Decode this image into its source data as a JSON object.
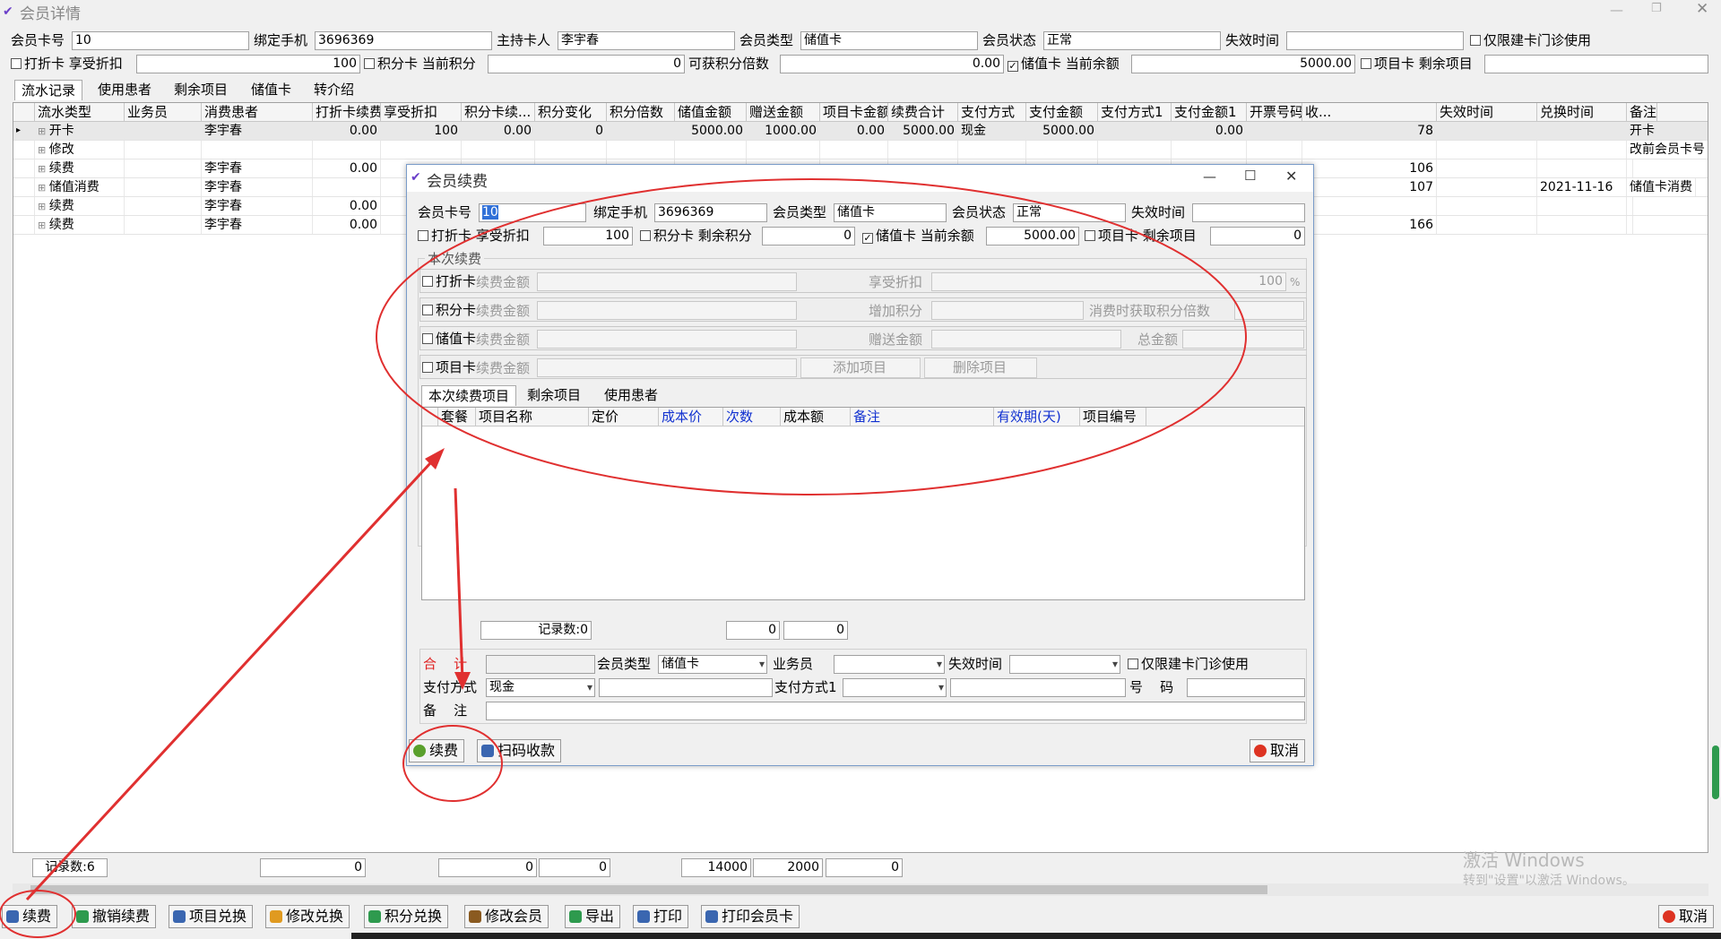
{
  "window": {
    "title": "会员详情"
  },
  "member": {
    "card_no_label": "会员卡号",
    "card_no": "10",
    "phone_label": "绑定手机",
    "phone": "3696369",
    "holder_label": "主持卡人",
    "holder": "李宇春",
    "type_label": "会员类型",
    "type": "储值卡",
    "status_label": "会员状态",
    "status": "正常",
    "expire_label": "失效时间",
    "expire": "",
    "clinic_only_label": "仅限建卡门诊使用",
    "discount_card_label": "打折卡",
    "discount_label": "享受折扣",
    "discount": "100",
    "points_card_label": "积分卡",
    "points_label": "当前积分",
    "points": "0",
    "points_multiplier_label": "可获积分倍数",
    "points_multiplier": "0.00",
    "stored_card_label": "储值卡",
    "balance_label": "当前余额",
    "balance": "5000.00",
    "project_card_label": "项目卡",
    "remaining_label": "剩余项目",
    "remaining": ""
  },
  "tabs": [
    "流水记录",
    "使用患者",
    "剩余项目",
    "储值卡",
    "转介绍"
  ],
  "main_table": {
    "columns": [
      "流水类型",
      "业务员",
      "消费患者",
      "打折卡续费金额",
      "享受折扣",
      "积分卡续...",
      "积分变化",
      "积分倍数",
      "储值金额",
      "赠送金额",
      "项目卡金额",
      "续费合计",
      "支付方式",
      "支付金额",
      "支付方式1",
      "支付金额1",
      "开票号码",
      "收...",
      "失效时间",
      "兑换时间",
      "备注"
    ],
    "rows": [
      [
        "开卡",
        "",
        "李宇春",
        "0.00",
        "100",
        "0.00",
        "0",
        "",
        "5000.00",
        "1000.00",
        "0.00",
        "5000.00",
        "现金",
        "5000.00",
        "",
        "0.00",
        "",
        "78",
        "",
        "",
        "开卡"
      ],
      [
        "修改",
        "",
        "",
        "",
        "",
        "",
        "",
        "",
        "",
        "",
        "",
        "",
        "",
        "",
        "",
        "",
        "",
        "",
        "",
        "",
        "改前会员卡号"
      ],
      [
        "续费",
        "",
        "李宇春",
        "0.00",
        "",
        "",
        "",
        "",
        "",
        "",
        "",
        "",
        "",
        "",
        "",
        "",
        "",
        "106",
        "",
        "",
        ""
      ],
      [
        "储值消费",
        "",
        "李宇春",
        "",
        "",
        "",
        "",
        "",
        "",
        "",
        "",
        "",
        "",
        "",
        "",
        "",
        "",
        "107",
        "",
        "2021-11-16",
        "储值卡消费"
      ],
      [
        "续费",
        "",
        "李宇春",
        "0.00",
        "",
        "",
        "",
        "",
        "",
        "",
        "",
        "",
        "",
        "",
        "",
        "",
        "",
        "",
        "",
        "",
        ""
      ],
      [
        "续费",
        "",
        "李宇春",
        "0.00",
        "",
        "",
        "",
        "",
        "",
        "",
        "",
        "",
        "",
        "",
        "",
        "",
        "",
        "166",
        "",
        "",
        ""
      ]
    ]
  },
  "footer_totals": {
    "record_count": "记录数:6",
    "t1": "0",
    "t2": "0",
    "t3": "0",
    "t4": "14000",
    "t5": "2000",
    "t6": "0"
  },
  "toolbar": [
    "续费",
    "撤销续费",
    "项目兑换",
    "修改兑换",
    "积分兑换",
    "修改会员",
    "导出",
    "打印",
    "打印会员卡"
  ],
  "cancel_label": "取消",
  "watermark": {
    "line1": "激活 Windows",
    "line2": "转到\"设置\"以激活 Windows。"
  },
  "dialog": {
    "title": "会员续费",
    "card_no_label": "会员卡号",
    "card_no": "10",
    "phone_label": "绑定手机",
    "phone": "3696369",
    "type_label": "会员类型",
    "type": "储值卡",
    "status_label": "会员状态",
    "status": "正常",
    "expire_label": "失效时间",
    "expire": "",
    "discount_card_label": "打折卡",
    "discount_label": "享受折扣",
    "discount": "100",
    "points_card_label": "积分卡",
    "points_label": "剩余积分",
    "points": "0",
    "stored_card_label": "储值卡",
    "balance_label": "当前余额",
    "balance": "5000.00",
    "project_card_label": "项目卡",
    "remaining_label": "剩余项目",
    "remaining": "0",
    "section_title": "本次续费",
    "opt_discount": "打折卡",
    "opt_points": "积分卡",
    "opt_stored": "储值卡",
    "opt_project": "项目卡",
    "fee_label": "续费金额",
    "enjoy_discount_label": "享受折扣",
    "enjoy_discount": "100",
    "percent": "%",
    "add_points_label": "增加积分",
    "multiplier_label": "消费时获取积分倍数",
    "gift_label": "赠送金额",
    "total_label": "总金额",
    "add_item": "添加项目",
    "del_item": "删除项目",
    "subtabs": [
      "本次续费项目",
      "剩余项目",
      "使用患者"
    ],
    "item_columns": [
      "套餐",
      "项目名称",
      "定价",
      "成本价",
      "次数",
      "成本额",
      "备注",
      "有效期(天)",
      "项目编号"
    ],
    "record_count": "记录数:0",
    "sum1": "0",
    "sum2": "0",
    "sum_label": "合    计",
    "sum_value": "",
    "member_type_label": "会员类型",
    "member_type": "储值卡",
    "staff_label": "业务员",
    "staff": "",
    "expire2_label": "失效时间",
    "expire2": "",
    "clinic_only_label": "仅限建卡门诊使用",
    "pay_label": "支付方式",
    "pay": "现金",
    "pay_amount": "",
    "pay1_label": "支付方式1",
    "pay1": "",
    "pay1_amount": "",
    "number_label": "号    码",
    "number": "",
    "note_label": "备    注",
    "note": "",
    "btn_renew": "续费",
    "btn_scan": "扫码收款",
    "btn_cancel": "取消"
  }
}
